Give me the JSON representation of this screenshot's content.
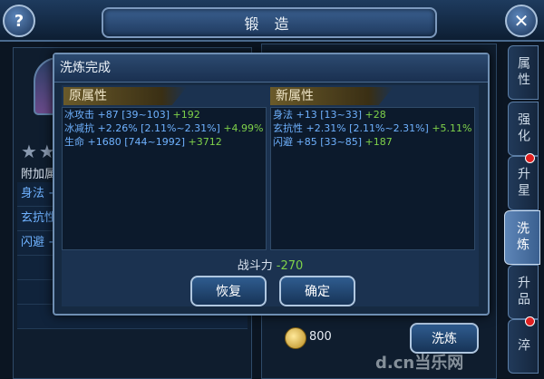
{
  "window": {
    "title": "锻 造"
  },
  "background": {
    "fujia_label": "附加属",
    "attr_rows": [
      "身法 +",
      "玄抗性",
      "闪避 +",
      "",
      "",
      ""
    ],
    "coin_amount": "800",
    "refine_button": "洗炼"
  },
  "side_tabs": [
    {
      "label": "属性",
      "active": false,
      "badge": false
    },
    {
      "label": "强化",
      "active": false,
      "badge": false
    },
    {
      "label": "升星",
      "active": false,
      "badge": true
    },
    {
      "label": "洗炼",
      "active": true,
      "badge": false
    },
    {
      "label": "升品",
      "active": false,
      "badge": false
    },
    {
      "label": "淬",
      "active": false,
      "badge": true
    }
  ],
  "dialog": {
    "title": "洗炼完成",
    "old_heading": "原属性",
    "new_heading": "新属性",
    "old_attrs": [
      {
        "base": "冰攻击 +87 [39~103]",
        "delta": "+192"
      },
      {
        "base": "冰减抗 +2.26% [2.11%~2.31%]",
        "delta": "+4.99%"
      },
      {
        "base": "生命 +1680 [744~1992]",
        "delta": "+3712"
      }
    ],
    "new_attrs": [
      {
        "base": "身法 +13 [13~33]",
        "delta": "+28"
      },
      {
        "base": "玄抗性 +2.31% [2.11%~2.31%]",
        "delta": "+5.11%"
      },
      {
        "base": "闪避 +85 [33~85]",
        "delta": "+187"
      }
    ],
    "combat_label": "战斗力",
    "combat_value": "-270",
    "restore_button": "恢复",
    "confirm_button": "确定"
  },
  "watermark": "d.cn当乐网"
}
